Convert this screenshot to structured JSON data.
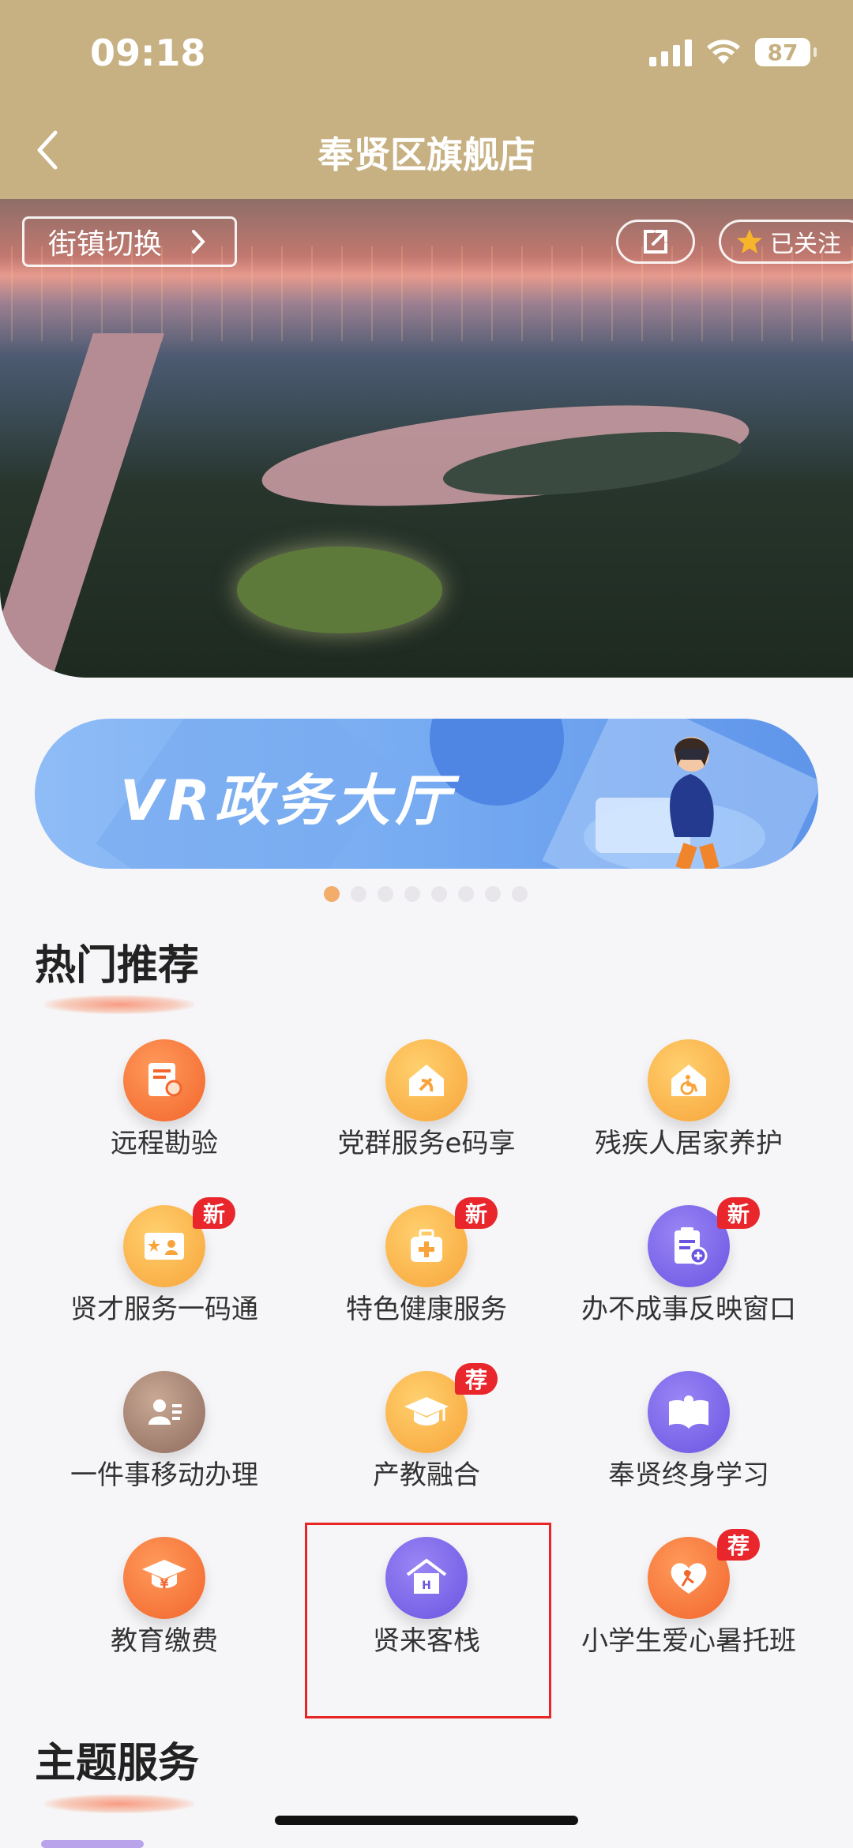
{
  "status_bar": {
    "time": "09:18",
    "battery": "87"
  },
  "nav": {
    "title": "奉贤区旗舰店"
  },
  "hero": {
    "switch_label": "街镇切换",
    "follow_label": "已关注"
  },
  "banner": {
    "title": "VR政务大厅",
    "active_dot": 0,
    "dot_count": 8
  },
  "hot": {
    "title": "热门推荐",
    "items": [
      {
        "label": "远程勘验",
        "icon": "document-person-icon",
        "color": "orange",
        "badge": ""
      },
      {
        "label": "党群服务e码享",
        "icon": "party-house-icon",
        "color": "amber",
        "badge": ""
      },
      {
        "label": "残疾人居家养护",
        "icon": "wheelchair-house-icon",
        "color": "amber",
        "badge": ""
      },
      {
        "label": "贤才服务一码通",
        "icon": "talent-card-icon",
        "color": "amber",
        "badge": "新"
      },
      {
        "label": "特色健康服务",
        "icon": "medical-kit-icon",
        "color": "amber",
        "badge": "新"
      },
      {
        "label": "办不成事反映窗口",
        "icon": "clipboard-plus-icon",
        "color": "purple",
        "badge": "新"
      },
      {
        "label": "一件事移动办理",
        "icon": "contact-card-icon",
        "color": "brown",
        "badge": ""
      },
      {
        "label": "产教融合",
        "icon": "graduation-cap-icon",
        "color": "amber",
        "badge": "荐"
      },
      {
        "label": "奉贤终身学习",
        "icon": "open-book-icon",
        "color": "purple",
        "badge": ""
      },
      {
        "label": "教育缴费",
        "icon": "cap-yen-icon",
        "color": "orange",
        "badge": ""
      },
      {
        "label": "贤来客栈",
        "icon": "hotel-house-icon",
        "color": "purple",
        "badge": ""
      },
      {
        "label": "小学生爱心暑托班",
        "icon": "heart-child-icon",
        "color": "orange",
        "badge": "荐"
      }
    ]
  },
  "theme": {
    "title": "主题服务"
  }
}
